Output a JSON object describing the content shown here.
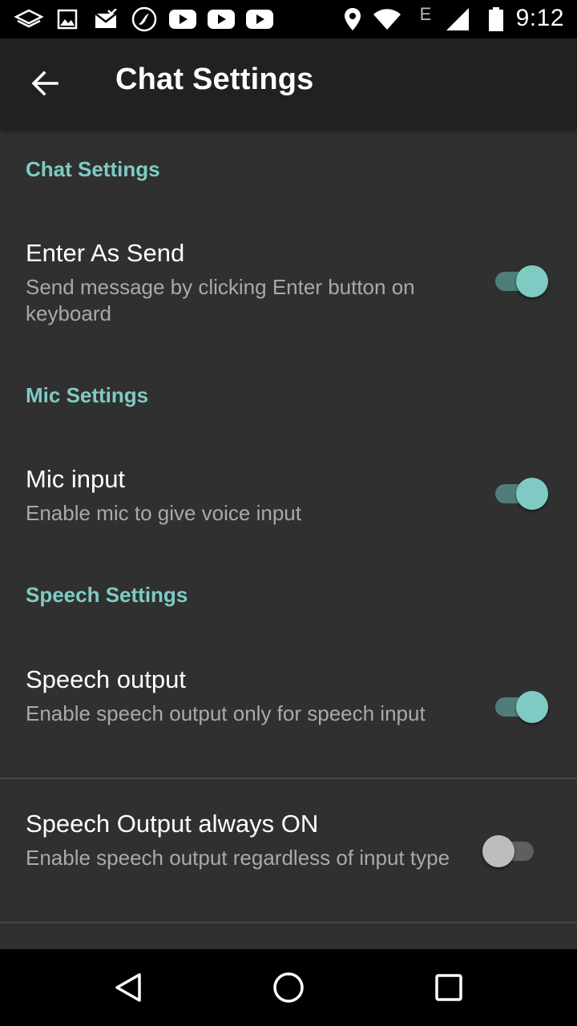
{
  "status_bar": {
    "time": "9:12",
    "network_type": "E",
    "icons": [
      "layers-icon",
      "image-icon",
      "mail-icon",
      "app-icon",
      "youtube-icon",
      "youtube-icon",
      "youtube-icon",
      "location-icon",
      "wifi-icon",
      "signal-icon",
      "battery-icon"
    ]
  },
  "app_bar": {
    "title": "Chat Settings",
    "back_icon": "arrow-back-icon"
  },
  "sections": [
    {
      "header": "Chat Settings",
      "items": [
        {
          "title": "Enter As Send",
          "summary": "Send message by clicking Enter button on keyboard",
          "enabled": true
        }
      ]
    },
    {
      "header": "Mic Settings",
      "items": [
        {
          "title": "Mic input",
          "summary": "Enable mic to give voice input",
          "enabled": true
        }
      ]
    },
    {
      "header": "Speech Settings",
      "items": [
        {
          "title": "Speech output",
          "summary": "Enable speech output only for speech input",
          "enabled": true
        },
        {
          "title": "Speech Output always ON",
          "summary": "Enable speech output regardless of input type",
          "enabled": false
        }
      ]
    }
  ],
  "nav_bar": {
    "icons": [
      "back-triangle-icon",
      "home-circle-icon",
      "recents-square-icon"
    ]
  },
  "colors": {
    "accent": "#7fcbc4",
    "background": "#303030",
    "app_bar": "#212121"
  }
}
